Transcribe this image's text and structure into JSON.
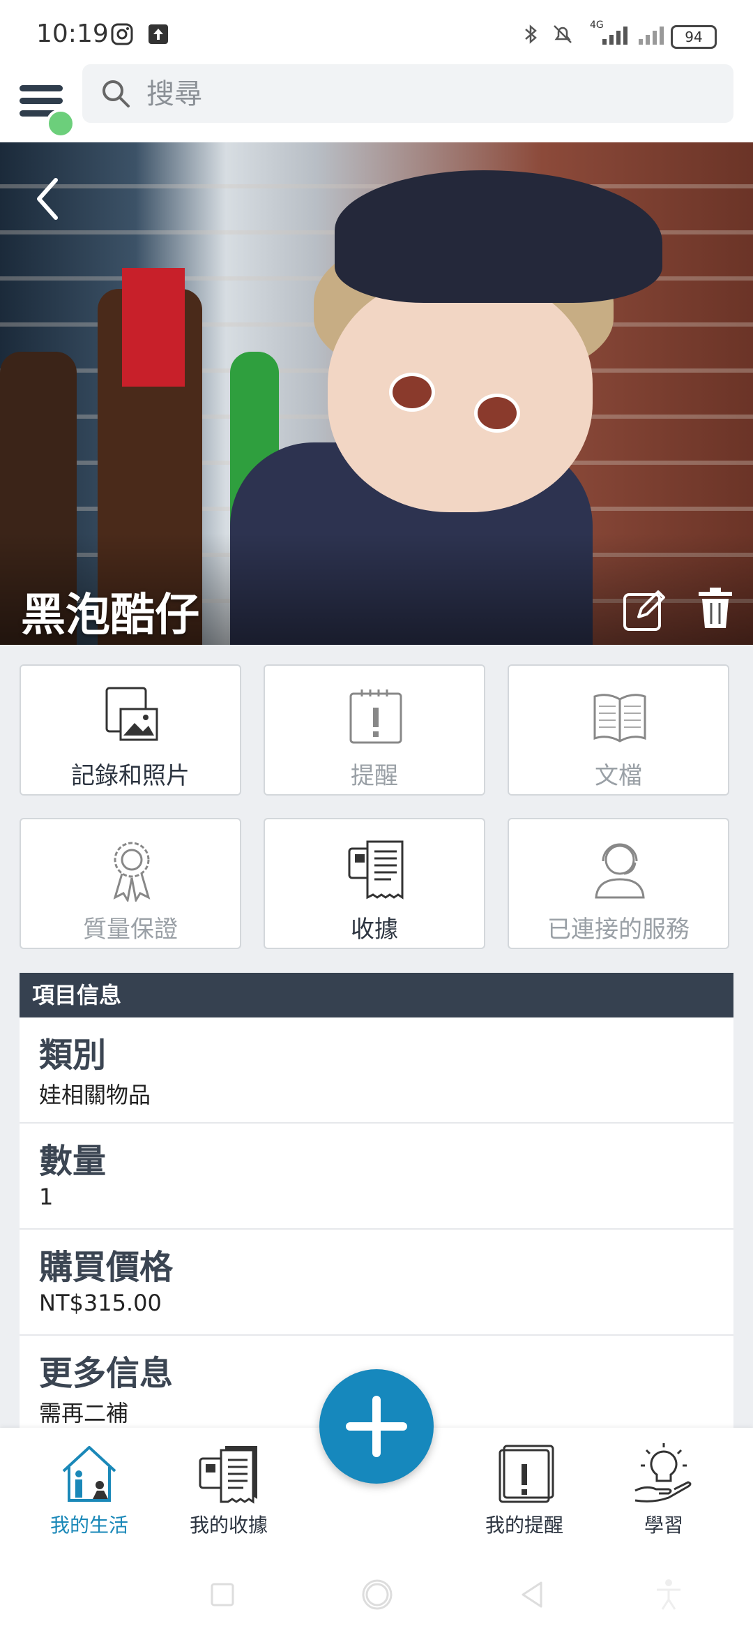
{
  "status_bar": {
    "time": "10:19",
    "battery": "94",
    "network": "4G"
  },
  "search": {
    "placeholder": "搜尋"
  },
  "item": {
    "title": "黑泡酷仔"
  },
  "tiles": [
    {
      "label": "記錄和照片",
      "icon": "notes-photo-icon",
      "enabled": true
    },
    {
      "label": "提醒",
      "icon": "reminder-icon",
      "enabled": false
    },
    {
      "label": "文檔",
      "icon": "document-book-icon",
      "enabled": false
    },
    {
      "label": "質量保證",
      "icon": "warranty-ribbon-icon",
      "enabled": false
    },
    {
      "label": "收據",
      "icon": "receipt-icon",
      "enabled": true
    },
    {
      "label": "已連接的服務",
      "icon": "support-agent-icon",
      "enabled": false
    }
  ],
  "info": {
    "header": "項目信息",
    "rows": [
      {
        "label": "類別",
        "value": "娃相關物品"
      },
      {
        "label": "數量",
        "value": "1"
      },
      {
        "label": "購買價格",
        "value": "NT$315.00"
      },
      {
        "label": "更多信息",
        "value": "需再二補"
      }
    ]
  },
  "tabbar": {
    "items": [
      {
        "label": "我的生活",
        "icon": "home-life-icon",
        "active": true
      },
      {
        "label": "我的收據",
        "icon": "receipts-icon",
        "active": false
      },
      {
        "label": "我的提醒",
        "icon": "reminders-icon",
        "active": false
      },
      {
        "label": "學習",
        "icon": "lightbulb-icon",
        "active": false
      }
    ]
  },
  "colors": {
    "accent": "#1688bd",
    "header_bg": "#364150",
    "page_bg": "#edeff2"
  }
}
